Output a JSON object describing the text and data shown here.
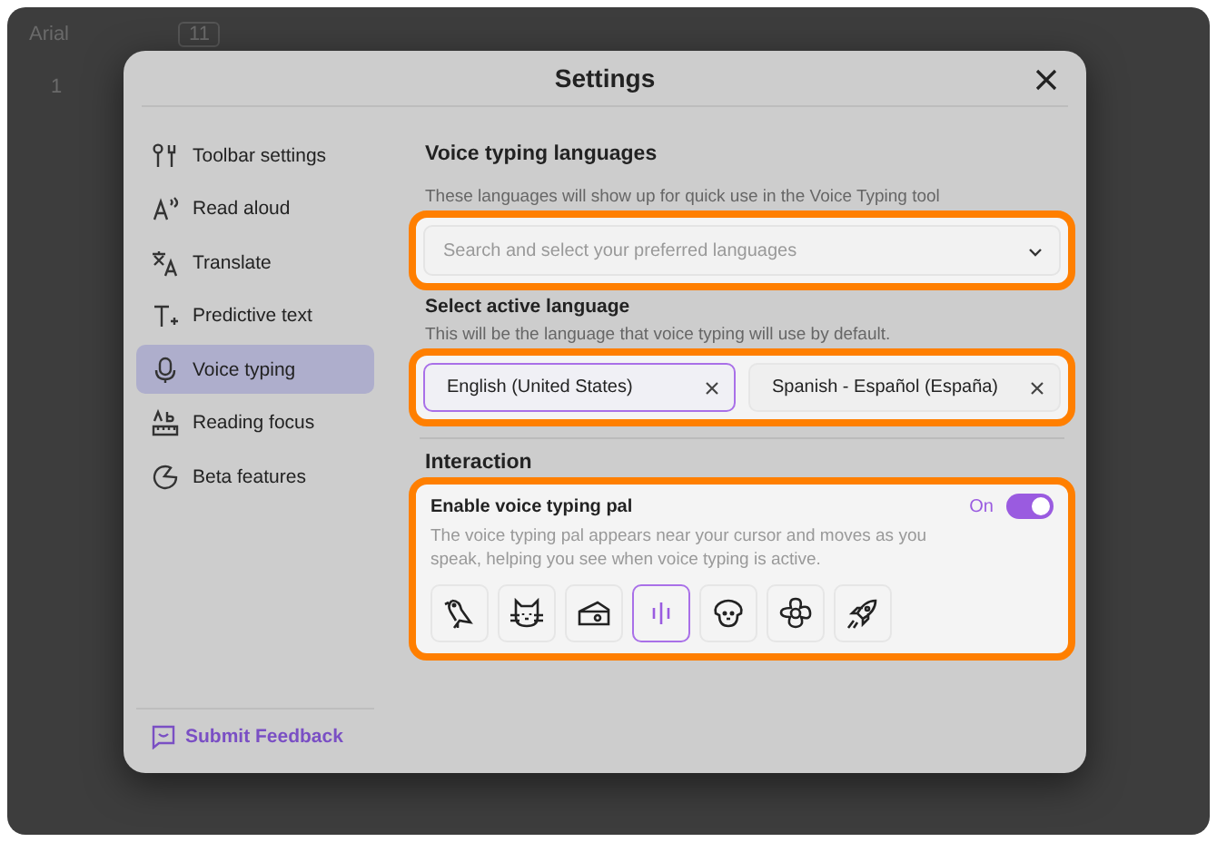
{
  "editor": {
    "font": "Arial",
    "font_size": "11",
    "ruler_mark": "1"
  },
  "dialog": {
    "title": "Settings"
  },
  "sidebar": {
    "items": [
      {
        "label": "Toolbar settings",
        "kind": "tools",
        "selected": false
      },
      {
        "label": "Read aloud",
        "kind": "speak",
        "selected": false
      },
      {
        "label": "Translate",
        "kind": "translate",
        "selected": false
      },
      {
        "label": "Predictive text",
        "kind": "predict",
        "selected": false
      },
      {
        "label": "Voice typing",
        "kind": "mic",
        "selected": true
      },
      {
        "label": "Reading focus",
        "kind": "ruler",
        "selected": false
      },
      {
        "label": "Beta features",
        "kind": "beta",
        "selected": false
      }
    ],
    "feedback": "Submit Feedback"
  },
  "languages": {
    "title": "Voice typing languages",
    "description": "These languages will show up for quick use in the Voice Typing tool",
    "search": {
      "placeholder": "Search and select your preferred languages"
    }
  },
  "active_language": {
    "title": "Select active language",
    "description": "This will be the language that voice typing will use by default.",
    "options": [
      {
        "label": "English (United States)",
        "selected": true
      },
      {
        "label": "Spanish - Español (España)",
        "selected": false
      }
    ]
  },
  "interaction": {
    "title": "Interaction",
    "pal": {
      "title": "Enable voice typing pal",
      "state_label": "On",
      "on": true,
      "description": "The voice typing pal appears near your cursor and moves as you speak, helping you see when voice typing is active.",
      "styles": [
        {
          "kind": "bird",
          "selected": false
        },
        {
          "kind": "cat",
          "selected": false
        },
        {
          "kind": "cheese",
          "selected": false
        },
        {
          "kind": "bars",
          "selected": true
        },
        {
          "kind": "dog",
          "selected": false
        },
        {
          "kind": "flower",
          "selected": false
        },
        {
          "kind": "rocket",
          "selected": false
        }
      ]
    }
  }
}
